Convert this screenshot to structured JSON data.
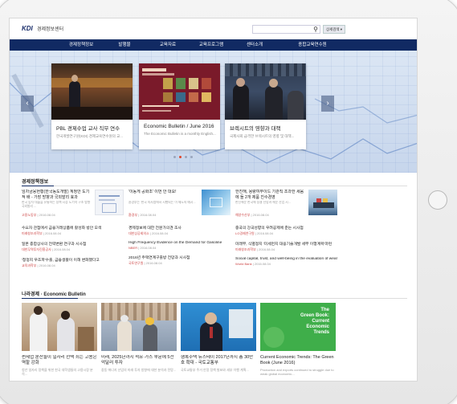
{
  "header": {
    "logo": "KDI",
    "logo_sub": "경제정보센터",
    "search_placeholder": "",
    "search_button": "상세검색 ▾"
  },
  "nav": [
    "경제정책정보",
    "발행물",
    "교육자료",
    "교육프로그램",
    "센터소개",
    "종합교육연수원"
  ],
  "hero": {
    "cards": [
      {
        "title": "PBL 경제수업 교사 직무 연수",
        "desc": "한국개발연구원(KDI) 경제교육연수원의 교..."
      },
      {
        "title": "Economic Bulletin / June 2016",
        "desc": "The Economic Bulletin is a monthly English..."
      },
      {
        "title": "브렉시트의 영향과 대책",
        "desc": "국제사회 급격한 브렉시트의 영향 및 대책..."
      }
    ],
    "prev_arrow": "‹",
    "next_arrow": "›",
    "mini_card_lines": [
      "The Green Book:",
      "Current Economic Trends",
      "Economic Bulletin",
      "Statistical Appendices"
    ]
  },
  "econ_info": {
    "title": "경제정책정보",
    "columns": [
      {
        "feature": {
          "title": "임차금융현황(한국동도개발) 계정안 도기적 배 - 가장 방향과 국외발리 효과",
          "desc": "한국 임차 대출을 유통하는 정책 시장 도기적 구조 방향 국외발리 ...",
          "source": "고용노동부",
          "date": "2016.08.04"
        },
        "list": [
          {
            "title": "수요자 관점에서 금융거래상품에 활성화 방안 모색",
            "source": "미래창조과학부",
            "date": "2016.08.04"
          },
          {
            "title": "일본 종합상사의 전략변환 연구과 시사점",
            "source": "대한무역투자진흥공사",
            "date": "2016.08.04"
          },
          {
            "title": "'청정지 우조파'수출, 금융생활이 이해 변화했다고",
            "source": "교육과학부",
            "date": "2016.08.04"
          }
        ]
      },
      {
        "feature": {
          "title": "'이동게 공화조' 이번 안 대요!",
          "desc": "환경부는 '한국 의사쌈에서 시행되는 이 제도의 예시...",
          "source": "환경부",
          "date": "2016.08.04"
        },
        "list": [
          {
            "title": "경제정보에 대한 전문가의견 조사",
            "source": "대한상공회의소",
            "date": "2016.08.04"
          },
          {
            "title": "High Frequency Evidence on the Demand for Gasoline",
            "source": "NBER",
            "date": "2016.08.04"
          },
          {
            "title": "2016년 주택연계구출방 전망과 시사점",
            "source": "국토연구원",
            "date": "2016.08.04"
          }
        ]
      },
      {
        "feature": {
          "title": "한진해, 용량여부이드 기관직 조과한 세움에 들 2개 제품 친수경영",
          "desc": "한진해운 한국에 정결 전망과 해운 산업 시...",
          "source": "해양수산부",
          "date": "2016.08.04"
        },
        "list": [
          {
            "title": "중국의 강국성향의 우려공제에 준는 시사점",
            "source": "LG경제연구원",
            "date": "2016.08.04"
          },
          {
            "title": "미래부, 식별정지 '미세먼지 대응기술개발 세부 이행계획'마련",
            "source": "미래창조과학부",
            "date": "2016.08.04"
          },
          {
            "title": "Social capital, trust, and well-being in the evaluation of wealth",
            "source": "World Bank",
            "date": "2016.08.04"
          }
        ]
      }
    ]
  },
  "bulletin": {
    "title": "나라경제 · Economic Bulletin",
    "cards": [
      {
        "title": "썬세업 분산들이 일자리 선택 최는 고용은 역할 강화",
        "desc": "청년 일자리 정책을 위한 한국 대학생들의 고용시장 분석..."
      },
      {
        "title": "미래, 2025년까지 석유·가스 부문에 5천억달러 투자",
        "desc": "중동 에너지 산업의 미래 투자 방향에 대한 분석과 전망..."
      },
      {
        "title": "행복주택 뉴스테이 2017년까지 총 30만호 확대 - 국토교통부",
        "desc": "국토교통부 주거 안정 정책 발표와 세부 이행 계획..."
      },
      {
        "title": "Current Economic Trends: The Green Book (June 2016)",
        "desc": "Production and exports continued to struggle due to weak global economic..."
      }
    ],
    "green_book_lines": [
      "The",
      "Green Book:",
      "Current",
      "Economic",
      "Trends"
    ]
  }
}
